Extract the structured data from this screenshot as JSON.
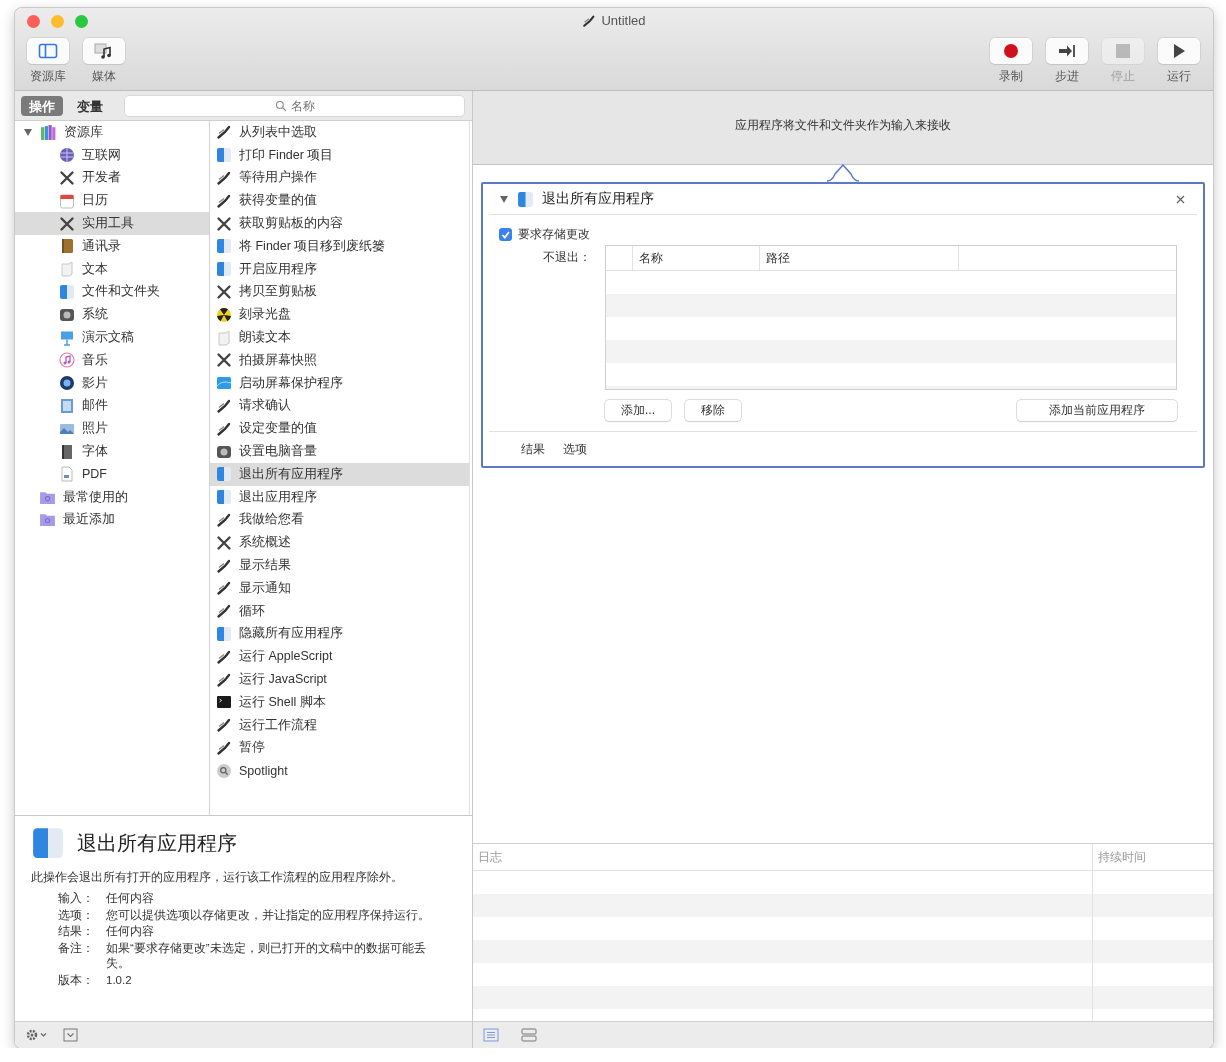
{
  "window": {
    "title": "Untitled"
  },
  "toolbar": {
    "left": [
      {
        "label": "资源库",
        "kind": "library"
      },
      {
        "label": "媒体",
        "kind": "media"
      }
    ],
    "right": [
      {
        "label": "录制",
        "kind": "record",
        "disabled": false
      },
      {
        "label": "步进",
        "kind": "step",
        "disabled": false
      },
      {
        "label": "停止",
        "kind": "stop",
        "disabled": true
      },
      {
        "label": "运行",
        "kind": "run",
        "disabled": false
      }
    ]
  },
  "tabs": [
    {
      "label": "操作",
      "selected": true
    },
    {
      "label": "变量",
      "selected": false
    }
  ],
  "search": {
    "placeholder": "名称"
  },
  "library": {
    "label": "资源库",
    "kind": "library",
    "expanded": true,
    "selected": false,
    "children": [
      {
        "label": "互联网",
        "kind": "globe",
        "selected": false
      },
      {
        "label": "开发者",
        "kind": "tools",
        "selected": false
      },
      {
        "label": "日历",
        "kind": "calendar",
        "selected": false
      },
      {
        "label": "实用工具",
        "kind": "tools",
        "selected": true
      },
      {
        "label": "通讯录",
        "kind": "contacts",
        "selected": false
      },
      {
        "label": "文本",
        "kind": "text",
        "selected": false
      },
      {
        "label": "文件和文件夹",
        "kind": "finder",
        "selected": false
      },
      {
        "label": "系统",
        "kind": "system",
        "selected": false
      },
      {
        "label": "演示文稿",
        "kind": "presentation",
        "selected": false
      },
      {
        "label": "音乐",
        "kind": "music",
        "selected": false
      },
      {
        "label": "影片",
        "kind": "movie",
        "selected": false
      },
      {
        "label": "邮件",
        "kind": "mail",
        "selected": false
      },
      {
        "label": "照片",
        "kind": "photo",
        "selected": false
      },
      {
        "label": "字体",
        "kind": "font",
        "selected": false
      },
      {
        "label": "PDF",
        "kind": "pdf",
        "selected": false
      }
    ]
  },
  "smart_folders": [
    {
      "label": "最常使用的",
      "kind": "folder",
      "selected": false
    },
    {
      "label": "最近添加",
      "kind": "folder",
      "selected": false
    }
  ],
  "actions": [
    {
      "label": "从列表中选取",
      "kind": "automator",
      "selected": false
    },
    {
      "label": "打印 Finder 项目",
      "kind": "finder",
      "selected": false
    },
    {
      "label": "等待用户操作",
      "kind": "automator",
      "selected": false
    },
    {
      "label": "获得变量的值",
      "kind": "automator",
      "selected": false
    },
    {
      "label": "获取剪贴板的内容",
      "kind": "tools",
      "selected": false
    },
    {
      "label": "将 Finder 项目移到废纸篓",
      "kind": "finder",
      "selected": false
    },
    {
      "label": "开启应用程序",
      "kind": "finder",
      "selected": false
    },
    {
      "label": "拷贝至剪贴板",
      "kind": "tools",
      "selected": false
    },
    {
      "label": "刻录光盘",
      "kind": "disc",
      "selected": false
    },
    {
      "label": "朗读文本",
      "kind": "text",
      "selected": false
    },
    {
      "label": "拍摄屏幕快照",
      "kind": "tools",
      "selected": false
    },
    {
      "label": "启动屏幕保护程序",
      "kind": "screensaver",
      "selected": false
    },
    {
      "label": "请求确认",
      "kind": "automator",
      "selected": false
    },
    {
      "label": "设定变量的值",
      "kind": "automator",
      "selected": false
    },
    {
      "label": "设置电脑音量",
      "kind": "system",
      "selected": false
    },
    {
      "label": "退出所有应用程序",
      "kind": "finder",
      "selected": true
    },
    {
      "label": "退出应用程序",
      "kind": "finder",
      "selected": false
    },
    {
      "label": "我做给您看",
      "kind": "automator",
      "selected": false
    },
    {
      "label": "系统概述",
      "kind": "tools",
      "selected": false
    },
    {
      "label": "显示结果",
      "kind": "automator",
      "selected": false
    },
    {
      "label": "显示通知",
      "kind": "automator",
      "selected": false
    },
    {
      "label": "循环",
      "kind": "automator",
      "selected": false
    },
    {
      "label": "隐藏所有应用程序",
      "kind": "finder",
      "selected": false
    },
    {
      "label": "运行 AppleScript",
      "kind": "automator",
      "selected": false
    },
    {
      "label": "运行 JavaScript",
      "kind": "automator",
      "selected": false
    },
    {
      "label": "运行 Shell 脚本",
      "kind": "terminal",
      "selected": false
    },
    {
      "label": "运行工作流程",
      "kind": "automator",
      "selected": false
    },
    {
      "label": "暂停",
      "kind": "automator",
      "selected": false
    },
    {
      "label": "Spotlight",
      "kind": "spotlight",
      "selected": false
    }
  ],
  "description": {
    "title": "退出所有应用程序",
    "summary": "此操作会退出所有打开的应用程序，运行该工作流程的应用程序除外。",
    "fields": [
      {
        "label": "输入：",
        "value": "任何内容"
      },
      {
        "label": "选项：",
        "value": "您可以提供选项以存储更改，并让指定的应用程序保持运行。"
      },
      {
        "label": "结果：",
        "value": "任何内容"
      },
      {
        "label": "备注：",
        "value": "如果“要求存储更改”未选定，则已打开的文稿中的数据可能丢失。"
      },
      {
        "label": "版本：",
        "value": "1.0.2"
      }
    ]
  },
  "workflow": {
    "input_note": "应用程序将文件和文件夹作为输入来接收",
    "action": {
      "title": "退出所有应用程序",
      "expanded": true,
      "ask_to_save": {
        "label": "要求存储更改",
        "checked": true
      },
      "keep_label": "不退出：",
      "columns": [
        "名称",
        "路径"
      ],
      "buttons": [
        "添加...",
        "移除",
        "添加当前应用程序"
      ],
      "footer_tabs": [
        "结果",
        "选项"
      ]
    }
  },
  "log": {
    "columns": [
      "日志",
      "持续时间"
    ]
  }
}
